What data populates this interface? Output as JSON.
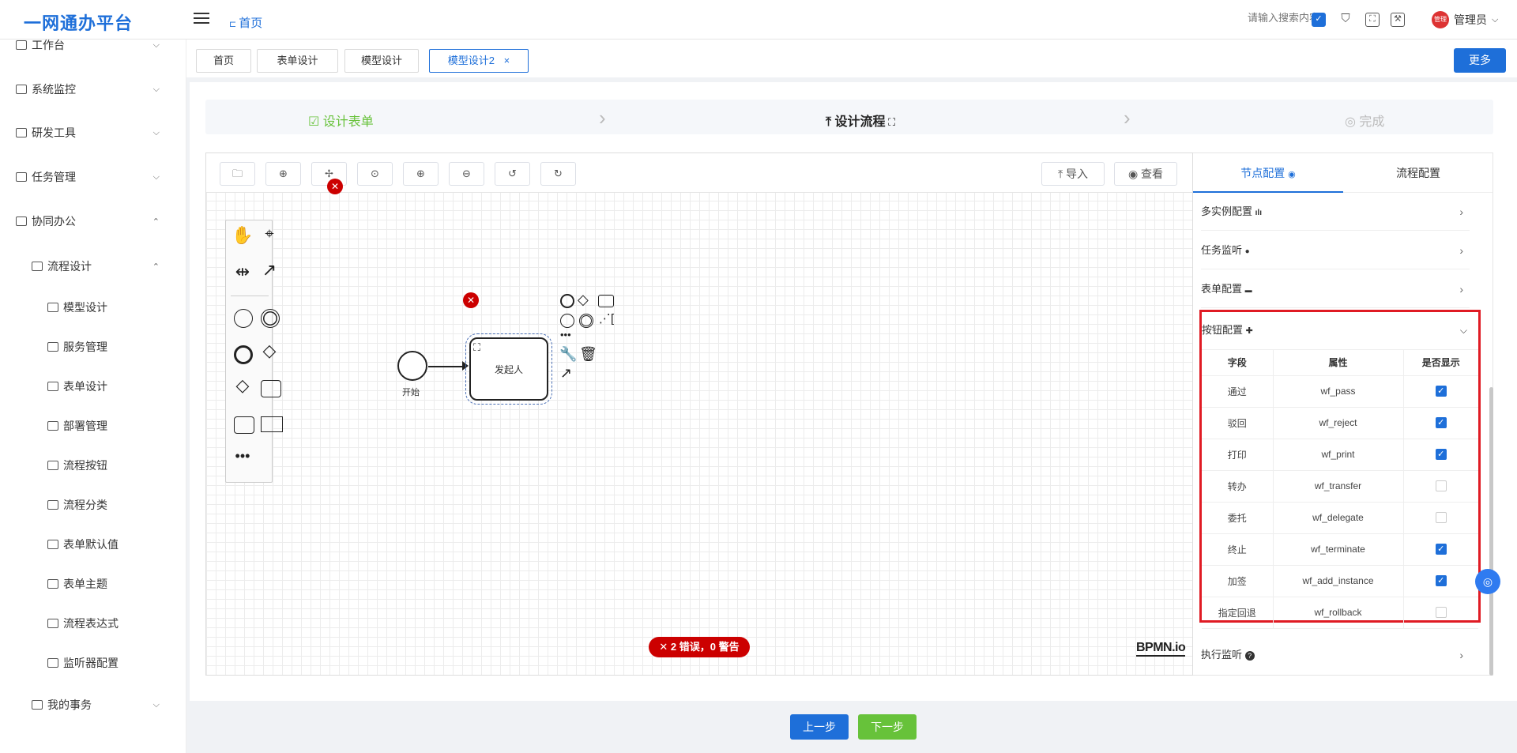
{
  "header": {
    "logo": "一网通办平台",
    "breadcrumb": "首页",
    "search_placeholder": "请输入搜索内容",
    "user": "管理员",
    "avatar_text": "管理"
  },
  "sidebar": {
    "items": [
      {
        "label": "工作台",
        "icon": "monitor-icon",
        "arrow": "⌵"
      },
      {
        "label": "系统监控",
        "icon": "bank-icon",
        "arrow": "⌵"
      },
      {
        "label": "研发工具",
        "icon": "code-icon",
        "arrow": "⌵"
      },
      {
        "label": "任务管理",
        "icon": "copy-icon",
        "arrow": "⌵"
      },
      {
        "label": "协同办公",
        "icon": "send-icon",
        "arrow": "⌃"
      },
      {
        "label": "流程设计",
        "icon": "flow-icon",
        "arrow": "⌃"
      },
      {
        "label": "模型设计",
        "icon": "text-icon"
      },
      {
        "label": "服务管理",
        "icon": "gear-icon"
      },
      {
        "label": "表单设计",
        "icon": "form-icon"
      },
      {
        "label": "部署管理",
        "icon": "chart-icon"
      },
      {
        "label": "流程按钮",
        "icon": "gear-icon"
      },
      {
        "label": "流程分类",
        "icon": "flow-icon"
      },
      {
        "label": "表单默认值",
        "icon": "edit-icon"
      },
      {
        "label": "表单主题",
        "icon": "theme-icon"
      },
      {
        "label": "流程表达式",
        "icon": "flag-icon"
      },
      {
        "label": "监听器配置",
        "icon": "toggle-icon"
      },
      {
        "label": "我的事务",
        "icon": "bell-icon",
        "arrow": "⌵"
      }
    ]
  },
  "tabs": [
    {
      "label": "首页"
    },
    {
      "label": "表单设计"
    },
    {
      "label": "模型设计"
    },
    {
      "label": "模型设计2",
      "close": "×"
    }
  ],
  "more_label": "更多",
  "steps": [
    {
      "label": "设计表单",
      "icon": "☑"
    },
    {
      "label": "设计流程",
      "icon": "⤒"
    },
    {
      "label": "完成",
      "icon": "◎"
    }
  ],
  "toolbar": {
    "import": "导入",
    "view": "查看"
  },
  "diagram": {
    "start_label": "开始",
    "task_label": "发起人",
    "errors": "2 错误，0 警告",
    "watermark": "BPMN.io"
  },
  "panel": {
    "tabs": [
      "节点配置",
      "流程配置"
    ],
    "sections": [
      {
        "label": "多实例配置",
        "badge": "ılı"
      },
      {
        "label": "任务监听",
        "badge": "●"
      },
      {
        "label": "表单配置",
        "badge": "▬"
      },
      {
        "label": "按钮配置",
        "badge": "✚"
      },
      {
        "label": "执行监听",
        "badge": "?"
      }
    ],
    "table": {
      "headers": [
        "字段",
        "属性",
        "是否显示"
      ],
      "rows": [
        {
          "field": "通过",
          "prop": "wf_pass",
          "show": true
        },
        {
          "field": "驳回",
          "prop": "wf_reject",
          "show": true
        },
        {
          "field": "打印",
          "prop": "wf_print",
          "show": true
        },
        {
          "field": "转办",
          "prop": "wf_transfer",
          "show": false
        },
        {
          "field": "委托",
          "prop": "wf_delegate",
          "show": false
        },
        {
          "field": "终止",
          "prop": "wf_terminate",
          "show": true
        },
        {
          "field": "加签",
          "prop": "wf_add_instance",
          "show": true
        },
        {
          "field": "指定回退",
          "prop": "wf_rollback",
          "show": false
        }
      ]
    }
  },
  "footer": {
    "prev": "上一步",
    "next": "下一步"
  },
  "colors": {
    "primary": "#1e6fd9",
    "success": "#67c23a",
    "error": "#cc0000",
    "highlight": "#e01b24"
  }
}
